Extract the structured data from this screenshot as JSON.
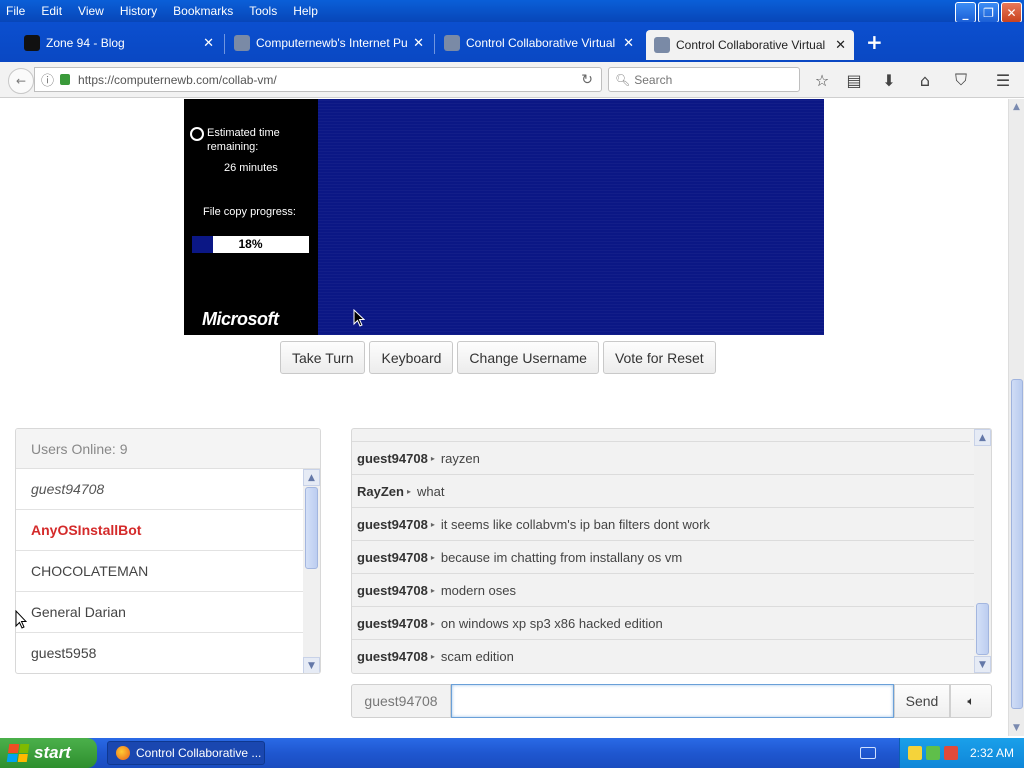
{
  "menubar": {
    "items": [
      "File",
      "Edit",
      "View",
      "History",
      "Bookmarks",
      "Tools",
      "Help"
    ]
  },
  "tabs": [
    {
      "title": "Zone 94 - Blog",
      "icon_color": "#111111"
    },
    {
      "title": "Computernewb's Internet Pu...",
      "icon_color": "#7a8aa6"
    },
    {
      "title": "Control Collaborative Virtual ...",
      "icon_color": "#7a8aa6"
    },
    {
      "title": "Control Collaborative Virtual ...",
      "icon_color": "#7a8aa6",
      "active": true
    }
  ],
  "new_tab_label": "+",
  "navbar": {
    "url": "https://computernewb.com/collab-vm/",
    "search_placeholder": "Search"
  },
  "vm": {
    "estimated_label": "Estimated time remaining:",
    "minutes": "26 minutes",
    "progress_label": "File copy progress:",
    "progress_percent": "18%",
    "progress_value": 0.18,
    "logo": "Microsoft"
  },
  "buttons": [
    "Take Turn",
    "Keyboard",
    "Change Username",
    "Vote for Reset"
  ],
  "users": {
    "header": "Users Online: 9",
    "list": [
      {
        "name": "guest94708",
        "style": "italic"
      },
      {
        "name": "AnyOSInstallBot",
        "style": "bot"
      },
      {
        "name": "CHOCOLATEMAN",
        "style": "normal"
      },
      {
        "name": "General Darian",
        "style": "normal"
      },
      {
        "name": "guest5958",
        "style": "normal"
      }
    ]
  },
  "chat": {
    "messages": [
      {
        "user": "guest94708",
        "text": "rayzen"
      },
      {
        "user": "RayZen",
        "text": "what"
      },
      {
        "user": "guest94708",
        "text": "it seems like collabvm's ip ban filters dont work"
      },
      {
        "user": "guest94708",
        "text": "because im chatting from installany os vm"
      },
      {
        "user": "guest94708",
        "text": "modern oses"
      },
      {
        "user": "guest94708",
        "text": "on windows xp sp3 x86 hacked edition"
      },
      {
        "user": "guest94708",
        "text": "scam edition"
      }
    ],
    "username": "guest94708",
    "send_label": "Send",
    "input_value": ""
  },
  "taskbar": {
    "start_label": "start",
    "task_title": "Control Collaborative ...",
    "clock": "2:32 AM"
  },
  "colors": {
    "vm_blue": "#0b1785",
    "bot_red": "#d42a2a",
    "xp_blue": "#1f57d0",
    "start_green": "#3a9f3a"
  }
}
